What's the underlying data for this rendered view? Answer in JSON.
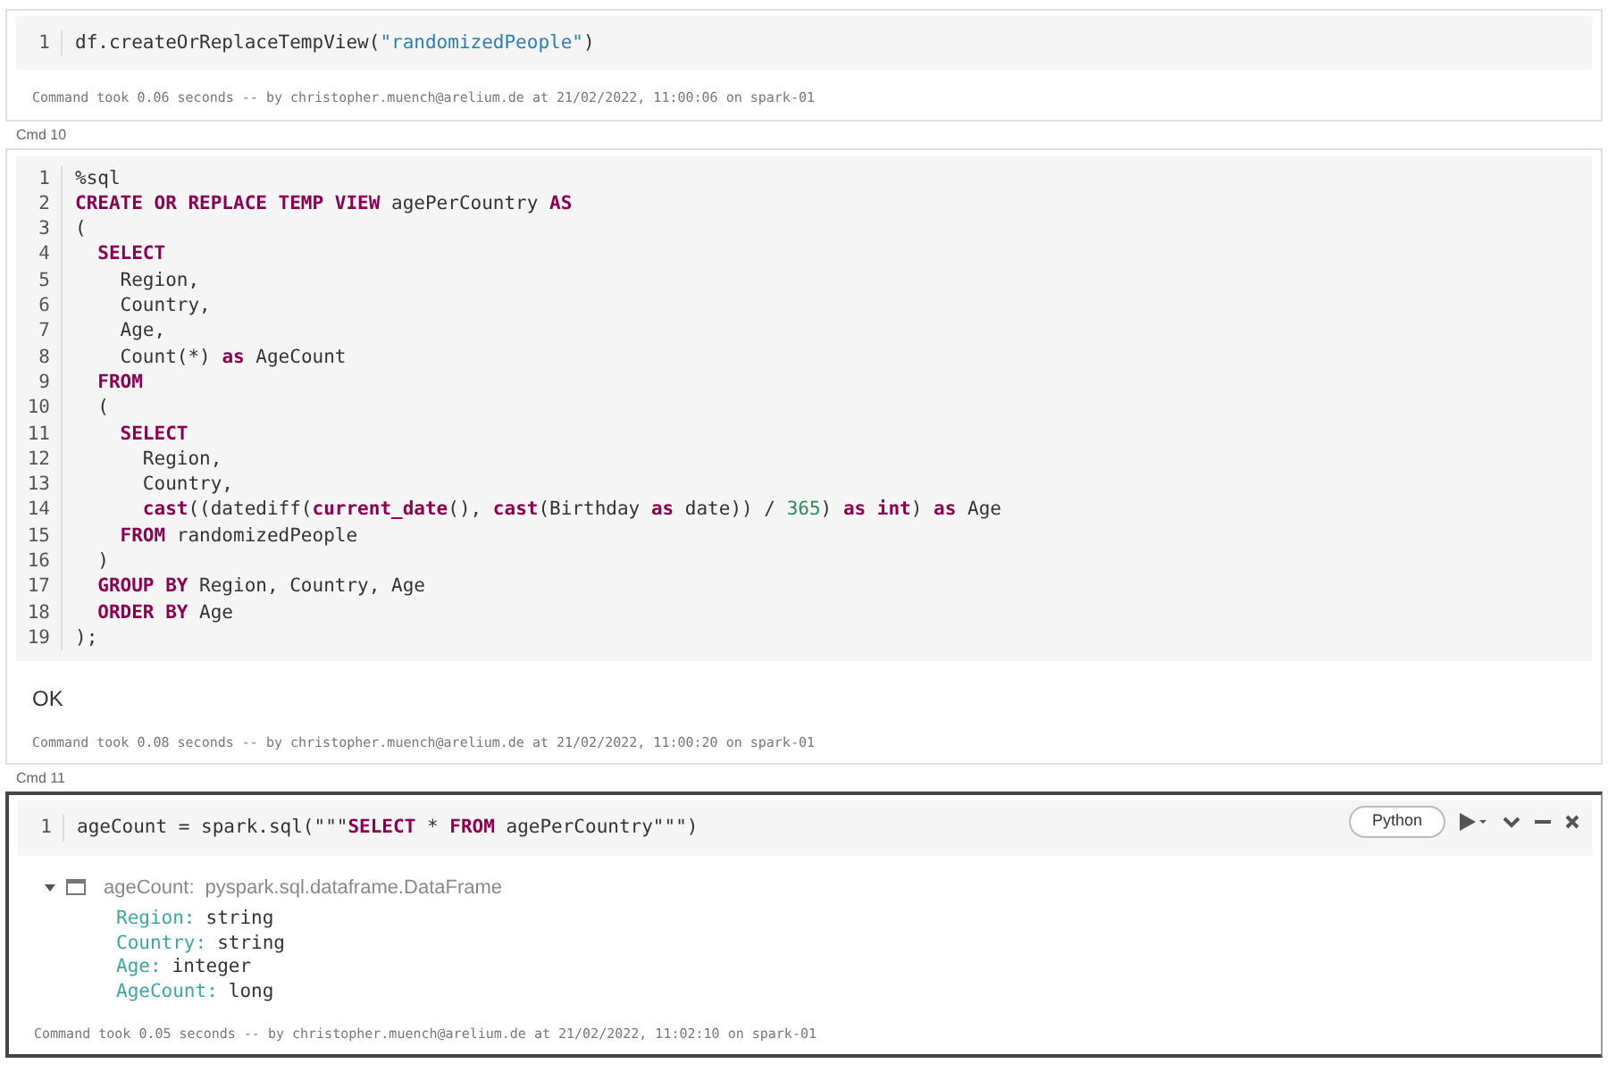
{
  "cells": [
    {
      "focused": false,
      "lines": [
        {
          "number": "1",
          "tokens": [
            {
              "t": "df.createOrReplaceTempView(",
              "kind": "plain"
            },
            {
              "t": "\"randomizedPeople\"",
              "kind": "str"
            },
            {
              "t": ")",
              "kind": "plain"
            }
          ]
        }
      ],
      "footer": "Command took 0.06 seconds -- by christopher.muench@arelium.de at 21/02/2022, 11:00:06 on spark-01"
    },
    {
      "label": "Cmd 10",
      "focused": false,
      "lines": [
        {
          "number": "1",
          "tokens": [
            {
              "t": "%sql",
              "kind": "plain"
            }
          ]
        },
        {
          "number": "2",
          "tokens": [
            {
              "t": "CREATE OR REPLACE TEMP VIEW",
              "kind": "kw"
            },
            {
              "t": " agePerCountry ",
              "kind": "plain"
            },
            {
              "t": "AS",
              "kind": "kw"
            }
          ]
        },
        {
          "number": "3",
          "tokens": [
            {
              "t": "(",
              "kind": "plain"
            }
          ]
        },
        {
          "number": "4",
          "tokens": [
            {
              "t": "  SELECT",
              "kind": "kw"
            }
          ]
        },
        {
          "number": "5",
          "tokens": [
            {
              "t": "    Region,",
              "kind": "plain"
            }
          ]
        },
        {
          "number": "6",
          "tokens": [
            {
              "t": "    Country,",
              "kind": "plain"
            }
          ]
        },
        {
          "number": "7",
          "tokens": [
            {
              "t": "    Age,",
              "kind": "plain"
            }
          ]
        },
        {
          "number": "8",
          "tokens": [
            {
              "t": "    Count(*) ",
              "kind": "plain"
            },
            {
              "t": "as",
              "kind": "kw"
            },
            {
              "t": " AgeCount",
              "kind": "plain"
            }
          ]
        },
        {
          "number": "9",
          "tokens": [
            {
              "t": "  FROM",
              "kind": "kw"
            }
          ]
        },
        {
          "number": "10",
          "tokens": [
            {
              "t": "  (",
              "kind": "plain"
            }
          ]
        },
        {
          "number": "11",
          "tokens": [
            {
              "t": "    SELECT",
              "kind": "kw"
            }
          ]
        },
        {
          "number": "12",
          "tokens": [
            {
              "t": "      Region,",
              "kind": "plain"
            }
          ]
        },
        {
          "number": "13",
          "tokens": [
            {
              "t": "      Country,",
              "kind": "plain"
            }
          ]
        },
        {
          "number": "14",
          "tokens": [
            {
              "t": "      cast",
              "kind": "kw"
            },
            {
              "t": "((datediff(",
              "kind": "plain"
            },
            {
              "t": "current_date",
              "kind": "kw"
            },
            {
              "t": "(), ",
              "kind": "plain"
            },
            {
              "t": "cast",
              "kind": "kw"
            },
            {
              "t": "(Birthday ",
              "kind": "plain"
            },
            {
              "t": "as",
              "kind": "kw"
            },
            {
              "t": " date)) / ",
              "kind": "plain"
            },
            {
              "t": "365",
              "kind": "num"
            },
            {
              "t": ") ",
              "kind": "plain"
            },
            {
              "t": "as int",
              "kind": "kw"
            },
            {
              "t": ") ",
              "kind": "plain"
            },
            {
              "t": "as",
              "kind": "kw"
            },
            {
              "t": " Age",
              "kind": "plain"
            }
          ]
        },
        {
          "number": "15",
          "tokens": [
            {
              "t": "    FROM",
              "kind": "kw"
            },
            {
              "t": " randomizedPeople",
              "kind": "plain"
            }
          ]
        },
        {
          "number": "16",
          "tokens": [
            {
              "t": "  )",
              "kind": "plain"
            }
          ]
        },
        {
          "number": "17",
          "tokens": [
            {
              "t": "  GROUP BY",
              "kind": "kw"
            },
            {
              "t": " Region, Country, Age",
              "kind": "plain"
            }
          ]
        },
        {
          "number": "18",
          "tokens": [
            {
              "t": "  ORDER BY",
              "kind": "kw"
            },
            {
              "t": " Age",
              "kind": "plain"
            }
          ]
        },
        {
          "number": "19",
          "tokens": [
            {
              "t": ");",
              "kind": "plain"
            }
          ]
        }
      ],
      "output": {
        "kind": "text",
        "text": "OK"
      },
      "footer": "Command took 0.08 seconds -- by christopher.muench@arelium.de at 21/02/2022, 11:00:20 on spark-01"
    },
    {
      "label": "Cmd 11",
      "focused": true,
      "language": "Python",
      "lines": [
        {
          "number": "1",
          "tokens": [
            {
              "t": "ageCount = spark.sql(\"\"\"",
              "kind": "plain"
            },
            {
              "t": "SELECT",
              "kind": "kw"
            },
            {
              "t": " * ",
              "kind": "plain"
            },
            {
              "t": "FROM",
              "kind": "kw"
            },
            {
              "t": " agePerCountry\"\"\")",
              "kind": "plain"
            }
          ]
        }
      ],
      "output": {
        "kind": "schema",
        "expanded": true,
        "name": "ageCount:",
        "type": "pyspark.sql.dataframe.DataFrame",
        "fields": [
          {
            "name": "Region:",
            "type": "string"
          },
          {
            "name": "Country:",
            "type": "string"
          },
          {
            "name": "Age:",
            "type": "integer"
          },
          {
            "name": "AgeCount:",
            "type": "long"
          }
        ]
      },
      "footer": "Command took 0.05 seconds -- by christopher.muench@arelium.de at 21/02/2022, 11:02:10 on spark-01"
    }
  ]
}
